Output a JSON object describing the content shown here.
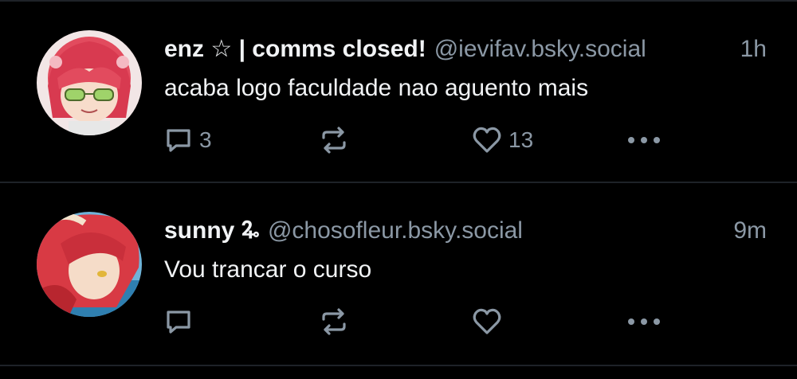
{
  "theme": {
    "background": "#000000",
    "text": "#f1f3f5",
    "muted": "#8b98a5",
    "divider": "#1e2228"
  },
  "posts": [
    {
      "display_name": "enz ☆ | comms closed!",
      "handle": "@ievifav.bsky.social",
      "time": "1h",
      "text": "acaba logo faculdade nao aguento mais",
      "replies": "3",
      "reposts": "",
      "likes": "13",
      "avatar": "avatar-red-hair-green-glasses"
    },
    {
      "display_name": "sunny 🜩",
      "handle": "@chosofleur.bsky.social",
      "time": "9m",
      "text": "Vou trancar o curso",
      "replies": "",
      "reposts": "",
      "likes": "",
      "avatar": "avatar-red-hair-anime-boy"
    }
  ],
  "icons": {
    "reply": "reply-icon",
    "repost": "repost-icon",
    "like": "heart-icon",
    "more": "more-icon"
  }
}
